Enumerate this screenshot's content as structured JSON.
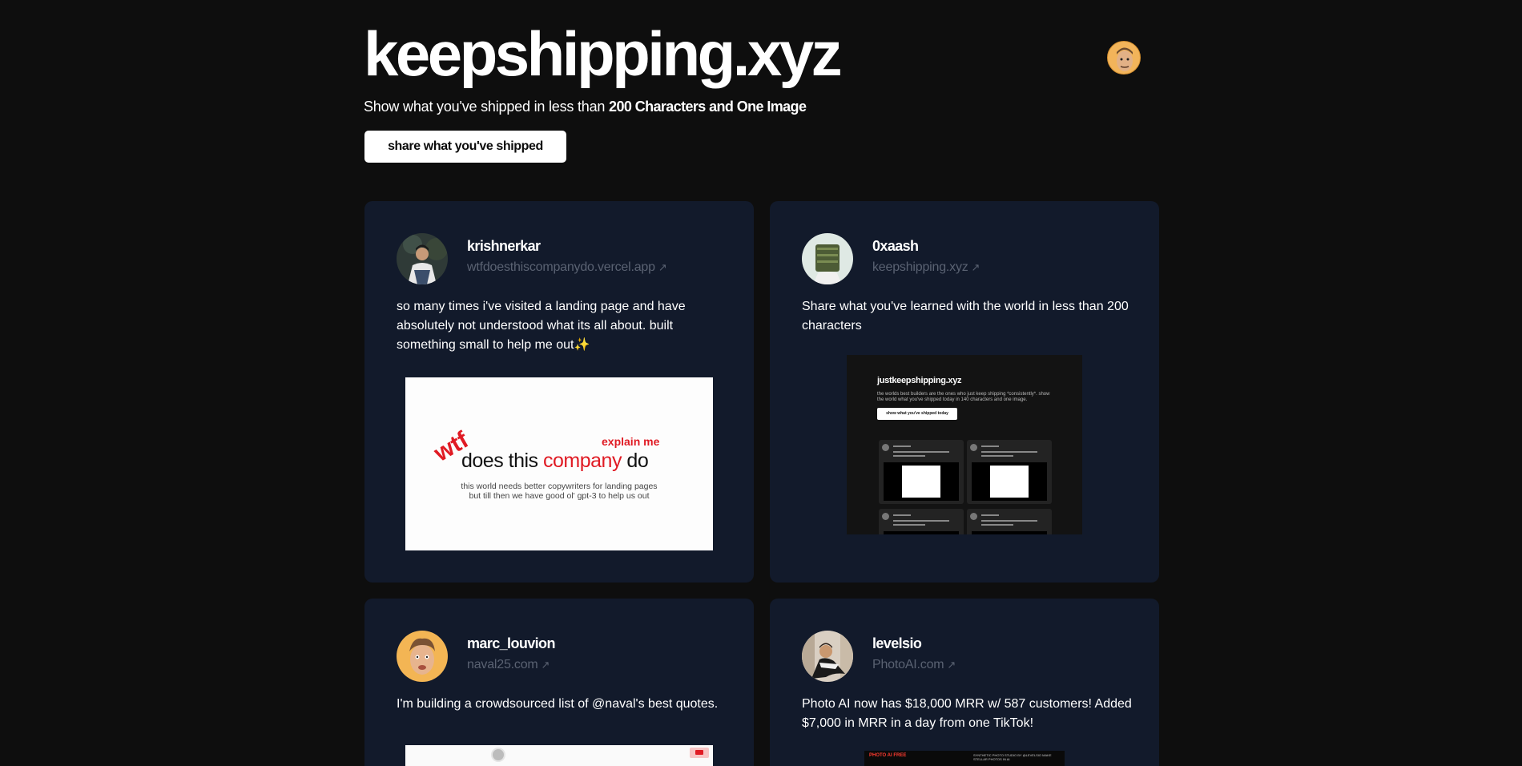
{
  "header": {
    "title": "keepshipping.xyz",
    "subtitle_prefix": "Show what you've shipped in less than ",
    "subtitle_bold": "200 Characters and One Image",
    "share_button": "share what you've shipped"
  },
  "posts": [
    {
      "username": "krishnerkar",
      "link": "wtfdoesthiscompanydo.vercel.app",
      "text": "so many times i've visited a landing page and have absolutely not understood what its all about. built something small to help me out✨",
      "image": {
        "wtf": "wtf",
        "explain": "explain me",
        "headline_a": "does this ",
        "headline_b": "company",
        "headline_c": " do",
        "tagline_1": "this world needs better copywriters for landing pages",
        "tagline_2": "but till then we have good ol' gpt-3 to help us out"
      }
    },
    {
      "username": "0xaash",
      "link": "keepshipping.xyz",
      "text": "Share what you've learned with the world in less than 200 characters",
      "image": {
        "title": "justkeepshipping.xyz",
        "sub": "the worlds best builders are the ones who just keep shipping *consistently*. show the world what you've shipped today in 140 characters and one image.",
        "button": "show what you've shipped today"
      }
    },
    {
      "username": "marc_louvion",
      "link": "naval25.com",
      "text": "I'm building a crowdsourced list of @naval's best quotes."
    },
    {
      "username": "levelsio",
      "link": "PhotoAI.com",
      "text": "Photo AI now has $18,000 MRR w/ 587 customers! Added $7,000 in MRR in a day from one TikTok!",
      "image": {
        "logo": "PHOTO AI FREE",
        "top": "SYNTHETIC PHOTO STUDIO BY @LEVELSIO MAKE STELLAR PHOTOS IN AI"
      }
    }
  ],
  "link_arrow": "↗"
}
